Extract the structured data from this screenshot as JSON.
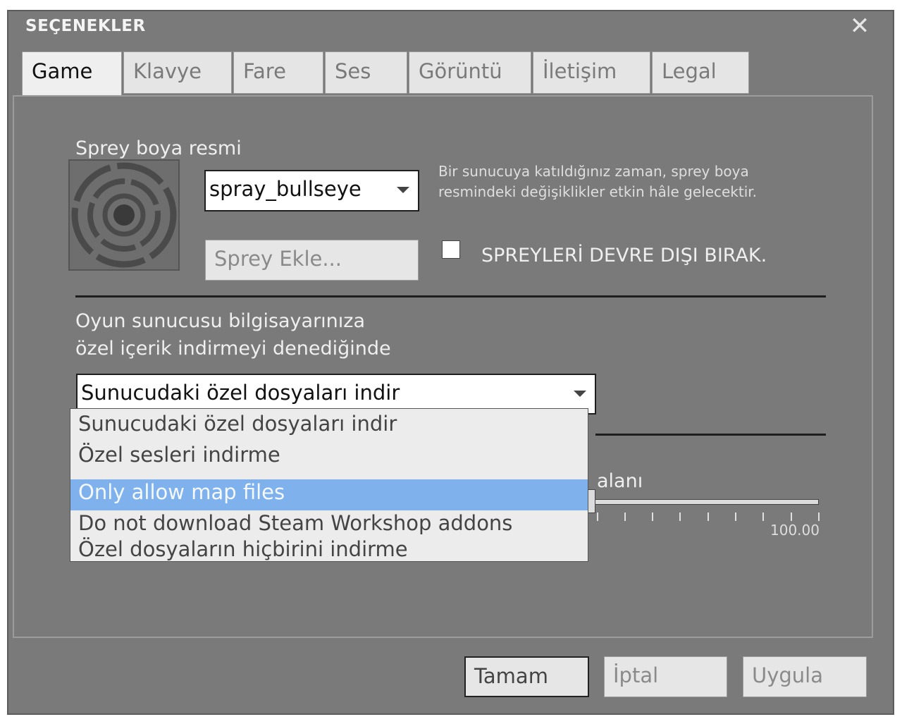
{
  "window": {
    "title": "SEÇENEKLER"
  },
  "tabs": [
    {
      "label": "Game",
      "active": true
    },
    {
      "label": "Klavye",
      "active": false
    },
    {
      "label": "Fare",
      "active": false
    },
    {
      "label": "Ses",
      "active": false
    },
    {
      "label": "Görüntü",
      "active": false
    },
    {
      "label": "İletişim",
      "active": false
    },
    {
      "label": "Legal",
      "active": false
    }
  ],
  "spray": {
    "section_label": "Sprey boya resmi",
    "selected_spray": "spray_bullseye",
    "add_button": "Sprey Ekle...",
    "hint_line1": "Bir sunucuya katıldığınız zaman, sprey boya",
    "hint_line2": "resmindeki değişiklikler etkin hâle gelecektir.",
    "disable_label": "SPREYLERİ DEVRE DIŞI BIRAK.",
    "disable_checked": false
  },
  "download": {
    "label_line1": "Oyun sunucusu bilgisayarınıza",
    "label_line2": "özel içerik indirmeyi denediğinde",
    "selected": "Sunucudaki özel dosyaları indir",
    "options": [
      {
        "label": "Sunucudaki özel dosyaları indir",
        "highlighted": false
      },
      {
        "label": "Özel sesleri indirme",
        "highlighted": false
      },
      {
        "label": "Only allow map files",
        "highlighted": true
      },
      {
        "label": "Do not download Steam Workshop addons",
        "highlighted": false
      },
      {
        "label": "Özel dosyaların hiçbirini indirme",
        "highlighted": false
      }
    ]
  },
  "slider": {
    "label_visible": "alanı",
    "max_label": "100.00",
    "value_fraction": 0.0
  },
  "footer": {
    "ok": "Tamam",
    "cancel": "İptal",
    "apply": "Uygula"
  },
  "colors": {
    "window_bg": "#7a7a7a",
    "highlight": "#7fb2ec"
  }
}
